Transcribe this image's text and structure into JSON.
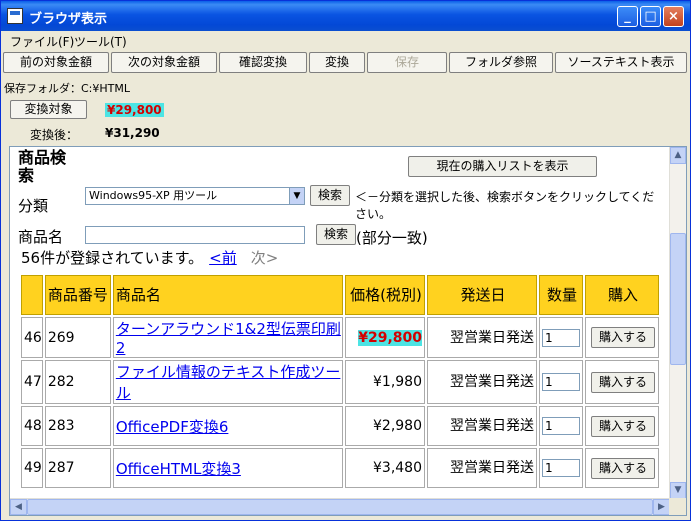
{
  "window": {
    "title": "ブラウザ表示",
    "min_icon": "minimize-icon",
    "max_icon": "maximize-icon",
    "close_icon": "close-icon"
  },
  "menu": [
    {
      "label": "ファイル(F)"
    },
    {
      "label": "ツール(T)"
    }
  ],
  "toolbar": {
    "prev_amount": "前の対象金額",
    "next_amount": "次の対象金額",
    "confirm_convert": "確認変換",
    "convert": "変換",
    "save": "保存",
    "folder_browse": "フォルダ参照",
    "source_text": "ソーステキスト表示"
  },
  "folder": {
    "line": "保存フォルダ：C:¥HTML"
  },
  "conversion": {
    "target_label": "変換対象",
    "target_value": "¥29,800",
    "after_label": "変換後：",
    "after_value": "¥31,290"
  },
  "page": {
    "heading": "商品検索",
    "list_button": "現在の購入リストを表示",
    "category_label": "分類",
    "category_selected": "Windows95-XP 用ツール",
    "search_button": "検索",
    "hint": "＜－分類を選択した後、検索ボタンをクリックしてください。",
    "name_label": "商品名",
    "partial_match": "(部分一致)",
    "count_text": "56件が登録されています。",
    "prev_link": "<前",
    "next_text": "次>",
    "headers": [
      "",
      "商品番号",
      "商品名",
      "価格(税別)",
      "発送日",
      "数量",
      "購入"
    ],
    "rows": [
      {
        "no": "46",
        "code": "269",
        "name": "ターンアラウンド1&2型伝票印刷2",
        "price": "¥29,800",
        "ship": "翌営業日発送",
        "qty": "1",
        "buy": "購入する",
        "highlight": true
      },
      {
        "no": "47",
        "code": "282",
        "name": "ファイル情報のテキスト作成ツール",
        "price": "¥1,980",
        "ship": "翌営業日発送",
        "qty": "1",
        "buy": "購入する",
        "highlight": false
      },
      {
        "no": "48",
        "code": "283",
        "name": "OfficePDF変換6",
        "price": "¥2,980",
        "ship": "翌営業日発送",
        "qty": "1",
        "buy": "購入する",
        "highlight": false
      },
      {
        "no": "49",
        "code": "287",
        "name": "OfficeHTML変換3",
        "price": "¥3,480",
        "ship": "翌営業日発送",
        "qty": "1",
        "buy": "購入する",
        "highlight": false
      }
    ]
  },
  "colors": {
    "header_bg": "#ffd21f",
    "highlight_bg": "#4ce4e4",
    "highlight_fg": "#d40000",
    "link": "#0000ee"
  }
}
